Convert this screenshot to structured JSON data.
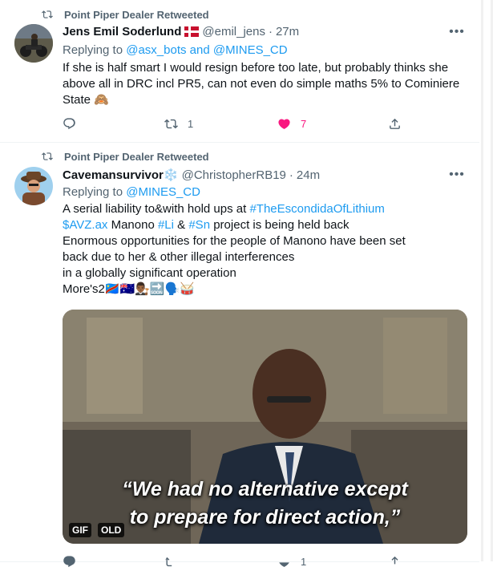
{
  "tweets": [
    {
      "retweeted_by": "Point Piper Dealer Retweeted",
      "author_name": "Jens Emil Soderlund",
      "author_handle": "@emil_jens",
      "dot": "·",
      "time": "27m",
      "replying_prefix": "Replying to",
      "replying_to": "@asx_bots and @MINES_CD",
      "text": "If she is half smart I would resign before too late, but probably thinks she above all in DRC incl PR5, can not even do simple maths 5% to Cominiere State 🙈",
      "retweets": "1",
      "likes": "7",
      "liked": true
    },
    {
      "retweeted_by": "Point Piper Dealer Retweeted",
      "author_name": "Cavemansurvivor",
      "name_emoji": "❄️",
      "author_handle": "@ChristopherRB19",
      "dot": "·",
      "time": "24m",
      "replying_prefix": "Replying to",
      "replying_to": "@MINES_CD",
      "text_parts": {
        "p1": "A serial liability to&with hold ups at ",
        "h1": "#TheEscondidaOfLithium",
        "h2": "$AVZ.ax",
        "p2": " Manono ",
        "h3": "#Li",
        "p3": " & ",
        "h4": "#Sn",
        "p4": " project is being held back Enormous opportunities for the people of Manono have been set back due to her & other illegal interferences",
        "line2": "in a globally significant operation",
        "line3": "More's2🇨🇩🇦🇺👨🏾‍⚖️🔜🗣️🥁"
      },
      "media": {
        "caption_line1": "“We had no alternative except",
        "caption_line2": "to prepare for direct action,”",
        "badge_gif": "GIF",
        "badge_old": "OLD"
      },
      "retweets": "",
      "likes": "1"
    }
  ],
  "icons": {
    "retweet": "retweet-icon",
    "reply": "reply-icon",
    "like": "heart-icon",
    "share": "share-icon",
    "more": "more-icon"
  },
  "colors": {
    "accent": "#1d9bf0",
    "like_active": "#f91880",
    "muted": "#536471"
  }
}
